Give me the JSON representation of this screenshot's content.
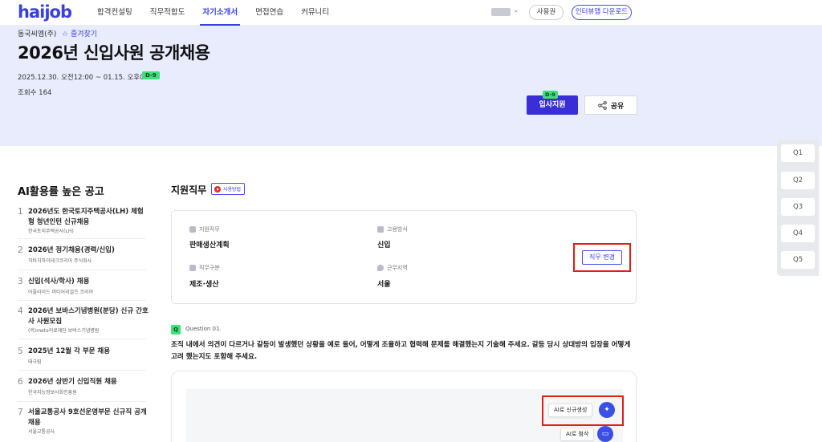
{
  "header": {
    "logo": "haijob",
    "nav": [
      "합격컨설팅",
      "직무적합도",
      "자기소개서",
      "면접연습",
      "커뮤니티"
    ],
    "active_nav": "자기소개서",
    "usage_label": "사용권",
    "download_label": "인터뷰앱 다운로드"
  },
  "posting": {
    "company": "동국씨엠(주)",
    "favorite": "즐겨찾기",
    "title": "2026년 신입사원 공개채용",
    "period": "2025.12.30. 오전12:00 ~ 01.15. 오후01:00",
    "dday": "D-9",
    "views": "조회수 164",
    "apply_label": "입사지원",
    "apply_dday": "D-9",
    "share_label": "공유"
  },
  "sidebar": {
    "title": "AI활용률 높은 공고",
    "items": [
      {
        "num": "1",
        "name": "2026년도 한국토지주택공사(LH) 체험형 청년인턴 신규채용",
        "org": "한국토지주택공사(LH)"
      },
      {
        "num": "2",
        "name": "2026년 정기채용(경력/신입)",
        "org": "히타치하이테크코리아 주식회사"
      },
      {
        "num": "3",
        "name": "신입(석사/학사) 채용",
        "org": "어플라이드 머티어리얼즈 코리아"
      },
      {
        "num": "4",
        "name": "2026년 보바스기념병원(분당) 신규 간호사 사원모집",
        "org": "(의)meta의료재단 보바스기념병원"
      },
      {
        "num": "5",
        "name": "2025년 12월 각 부문 채용",
        "org": "태극림"
      },
      {
        "num": "6",
        "name": "2026년 상반기 신입직원 채용",
        "org": "한국지능정보사회진흥원"
      },
      {
        "num": "7",
        "name": "서울교통공사 9호선운영부문 신규직 공개채용",
        "org": "서울교통공사"
      }
    ]
  },
  "job": {
    "section_title": "지원직무",
    "howto_label": "사용방법",
    "fields": [
      {
        "label": "지원직무",
        "value": "판매생산계획"
      },
      {
        "label": "고용방식",
        "value": "신입"
      },
      {
        "label": "직무구분",
        "value": "제조·생산"
      },
      {
        "label": "근무지역",
        "value": "서울"
      }
    ],
    "change_label": "직무 변경"
  },
  "question": {
    "badge": "Q",
    "label": "Question 01.",
    "text": "조직 내에서 의견이 다르거나 갈등이 발생했던 상황을 예로 들어, 어떻게 조율하고 협력해 문제를 해결했는지 기술해 주세요. 갈등 당시 상대방의 입장을 어떻게 고려 했는지도 포함해 주세요.",
    "ai_generate_label": "AI로 신규생성",
    "ai_review_label": "AI로 첨삭"
  },
  "qnav": [
    "Q1",
    "Q2",
    "Q3",
    "Q4",
    "Q5"
  ],
  "colors": {
    "accent": "#3a3fe0",
    "dday_green": "#3ee07a",
    "hero_bg": "#e8ecfc",
    "highlight_red": "#e31b1b"
  }
}
